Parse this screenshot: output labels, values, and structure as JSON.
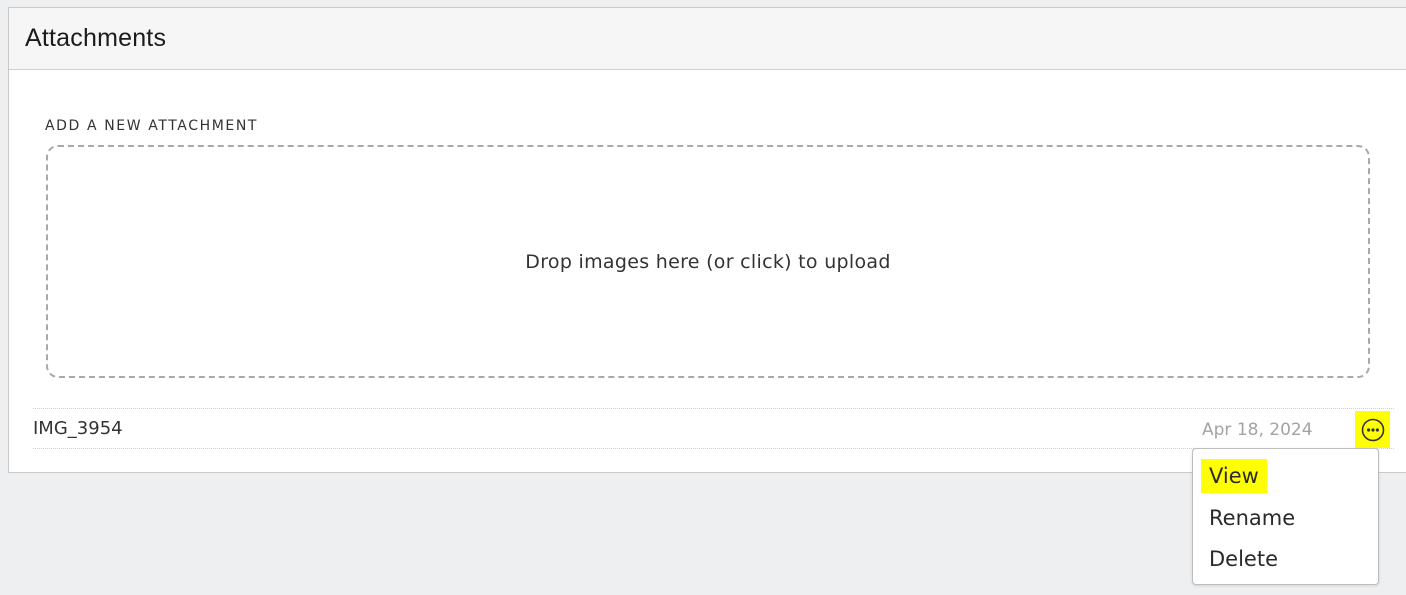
{
  "panel": {
    "title": "Attachments"
  },
  "upload": {
    "section_label": "ADD A NEW ATTACHMENT",
    "dropzone_text": "Drop images here (or click) to upload"
  },
  "attachments": [
    {
      "name": "IMG_3954",
      "date": "Apr 18, 2024",
      "menu_icon": "more-horizontal-circle-icon"
    }
  ],
  "context_menu": {
    "items": [
      {
        "label": "View",
        "highlighted": true
      },
      {
        "label": "Rename",
        "highlighted": false
      },
      {
        "label": "Delete",
        "highlighted": false
      }
    ]
  },
  "colors": {
    "highlight": "#ffff00",
    "page_background": "#eeeff1",
    "header_background": "#f6f6f6",
    "date_text": "#a3a3a3"
  }
}
